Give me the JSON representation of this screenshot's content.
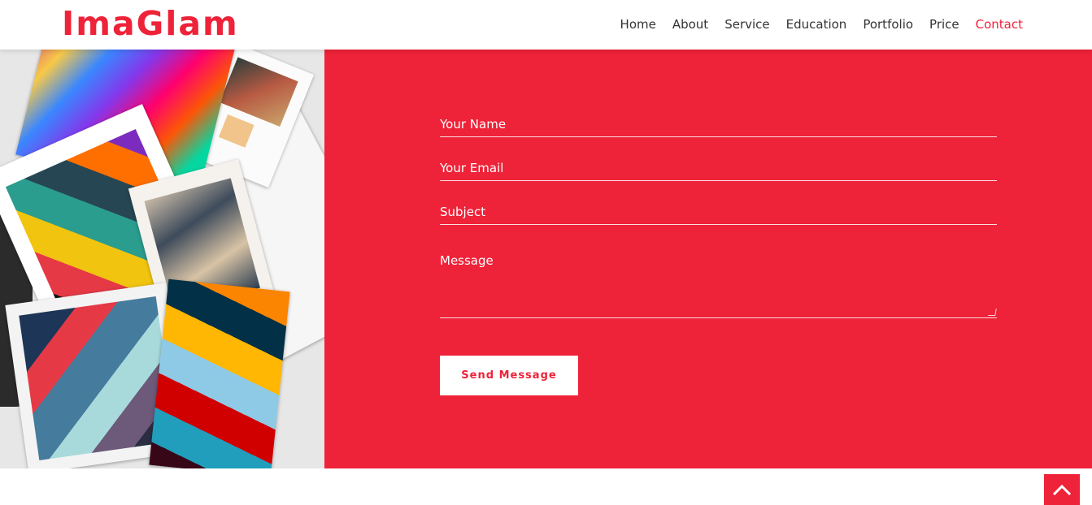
{
  "header": {
    "logo": "ImaGlam",
    "nav": [
      {
        "label": "Home"
      },
      {
        "label": "About"
      },
      {
        "label": "Service"
      },
      {
        "label": "Education"
      },
      {
        "label": "Portfolio"
      },
      {
        "label": "Price"
      },
      {
        "label": "Contact",
        "active": true
      }
    ]
  },
  "form": {
    "name_placeholder": "Your Name",
    "email_placeholder": "Your Email",
    "subject_placeholder": "Subject",
    "message_placeholder": "Message",
    "submit_label": "Send Message"
  },
  "colors": {
    "brand": "#ee2238",
    "text": "#333333",
    "button_bg": "#ffffff"
  },
  "icons": {
    "back_to_top": "chevron-up-icon"
  }
}
